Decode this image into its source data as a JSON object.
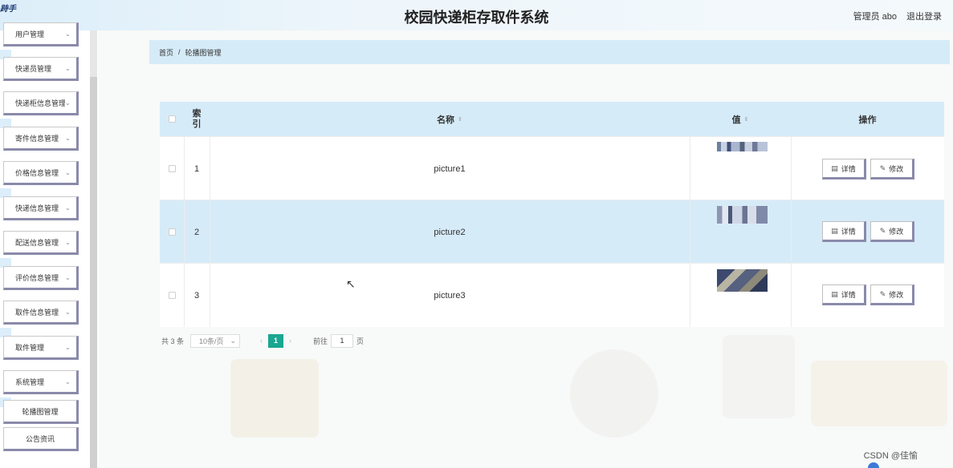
{
  "header": {
    "logo_text": "跱手",
    "title": "校园快递柜存取件系统",
    "user": "管理员 abo",
    "logout": "退出登录"
  },
  "sidebar": {
    "items": [
      {
        "label": "用户管理"
      },
      {
        "label": "快递员管理"
      },
      {
        "label": "快递柜信息管理"
      },
      {
        "label": "寄件信息管理"
      },
      {
        "label": "价格信息管理"
      },
      {
        "label": "快递信息管理"
      },
      {
        "label": "配送信息管理"
      },
      {
        "label": "评价信息管理"
      },
      {
        "label": "取件信息管理"
      },
      {
        "label": "取件管理"
      },
      {
        "label": "系统管理"
      },
      {
        "label": "轮播图管理"
      },
      {
        "label": "公告资讯"
      }
    ]
  },
  "breadcrumb": {
    "home": "首页",
    "separator": "/",
    "current": "轮播图管理"
  },
  "table": {
    "headers": {
      "index": "索\n引",
      "name": "名称",
      "value": "值",
      "actions": "操作"
    },
    "rows": [
      {
        "index": "1",
        "name": "picture1"
      },
      {
        "index": "2",
        "name": "picture2"
      },
      {
        "index": "3",
        "name": "picture3"
      }
    ],
    "detail_label": "详情",
    "edit_label": "修改"
  },
  "pagination": {
    "total": "共 3 条",
    "page_size": "10条/页",
    "current_page": "1",
    "goto_label": "前往",
    "goto_value": "1",
    "page_unit": "页"
  },
  "watermark": "CSDN @佳愉",
  "colors": {
    "header_bg": "#dceef9",
    "highlight": "#d6ebf8",
    "pager_active": "#1aa690",
    "button_shadow": "#8a8aaa"
  }
}
